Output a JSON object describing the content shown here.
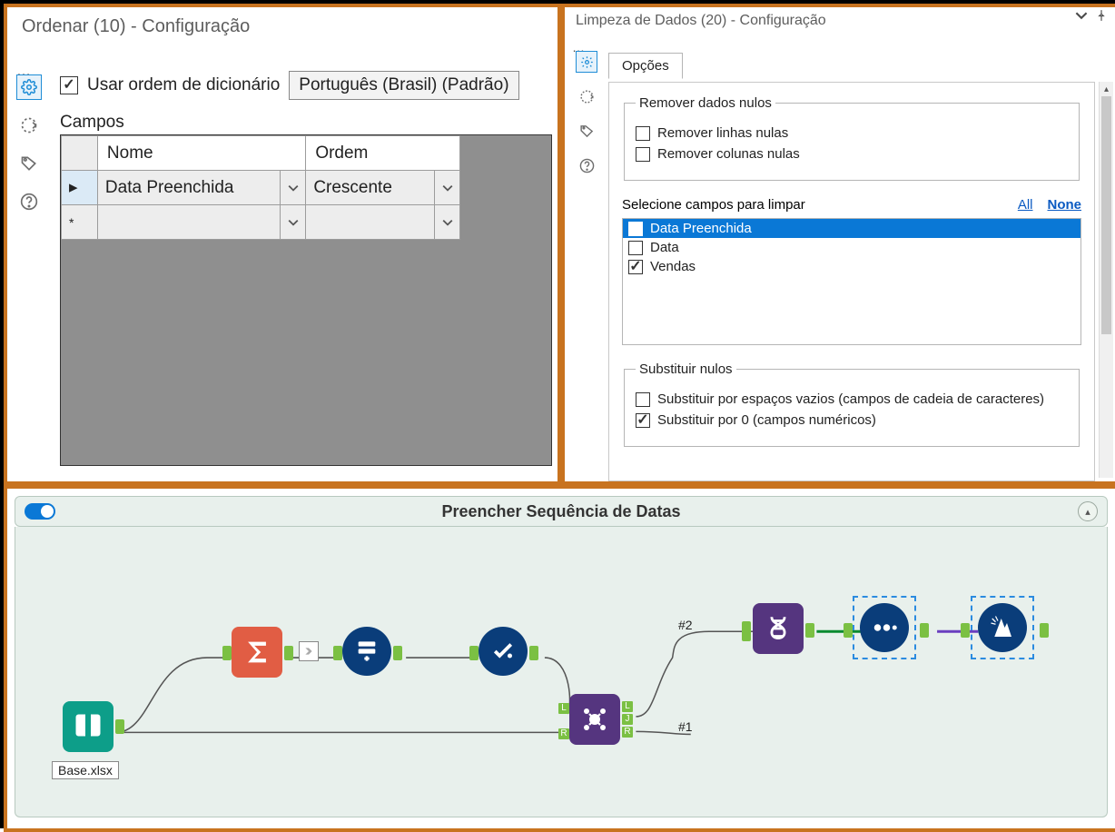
{
  "left": {
    "title": "Ordenar (10) - Configuração",
    "use_dict_label": "Usar ordem de dicionário",
    "language": "Português (Brasil) (Padrão)",
    "fields_label": "Campos",
    "headers": {
      "name": "Nome",
      "order": "Ordem"
    },
    "row1": {
      "name": "Data Preenchida",
      "order": "Crescente"
    }
  },
  "right": {
    "title": "Limpeza de Dados (20) - Configuração",
    "tab_options": "Opções",
    "group_null_title": "Remover dados nulos",
    "remove_null_rows": "Remover linhas nulas",
    "remove_null_cols": "Remover colunas nulas",
    "select_fields_label": "Selecione campos para limpar",
    "link_all": "All",
    "link_none": "None",
    "fields": [
      {
        "label": "Data Preenchida",
        "checked": false,
        "selected": true
      },
      {
        "label": "Data",
        "checked": false,
        "selected": false
      },
      {
        "label": "Vendas",
        "checked": true,
        "selected": false
      }
    ],
    "group_replace_title": "Substituir nulos",
    "replace_blank": "Substituir por espaços vazios (campos de cadeia de caracteres)",
    "replace_zero": "Substituir por 0 (campos numéricos)"
  },
  "workflow": {
    "title": "Preencher Sequência de Datas",
    "input_label": "Base.xlsx",
    "join_tag_2": "#2",
    "join_tag_1": "#1"
  }
}
